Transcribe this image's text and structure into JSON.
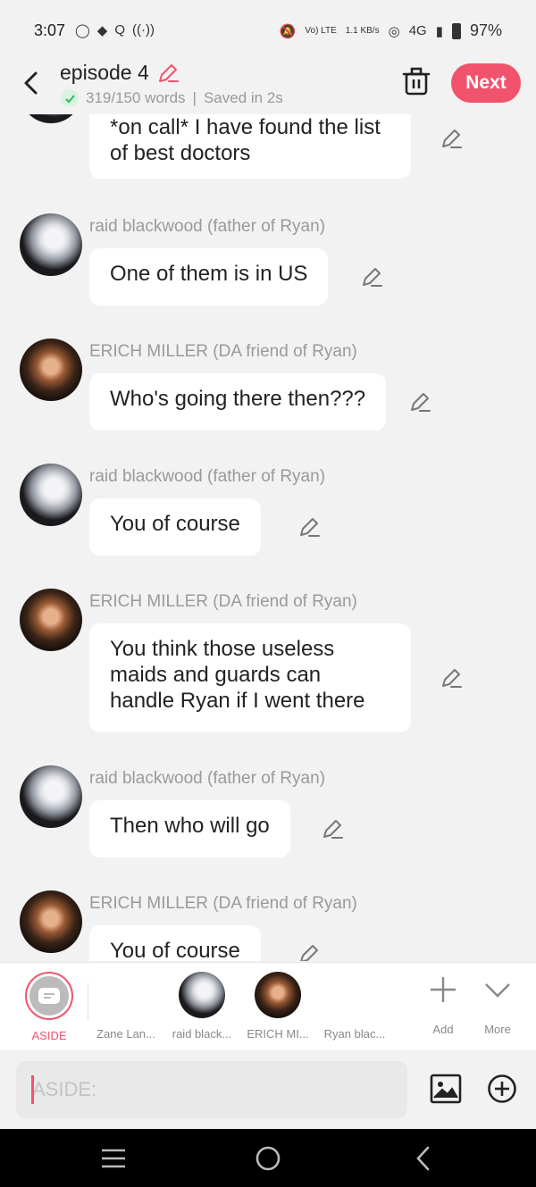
{
  "status": {
    "time": "3:07",
    "network_label": "Vo) LTE",
    "speed": "1.1 KB/s",
    "signal": "4G",
    "battery": "97%"
  },
  "header": {
    "title": "episode 4",
    "word_count": "319/150 words",
    "separator": "|",
    "saved": "Saved in 2s",
    "next_label": "Next"
  },
  "messages": [
    {
      "sender": "",
      "text": "*on call* I have found the list of best doctors",
      "avatar": "raid"
    },
    {
      "sender": "raid blackwood (father of Ryan)",
      "text": "One of them is in US",
      "avatar": "raid"
    },
    {
      "sender": "ERICH MILLER (DA friend of Ryan)",
      "text": "Who's going there then???",
      "avatar": "erich"
    },
    {
      "sender": "raid blackwood (father of Ryan)",
      "text": "You of course",
      "avatar": "raid"
    },
    {
      "sender": "ERICH MILLER (DA friend of Ryan)",
      "text": "You think those useless maids and guards can handle Ryan if I went there",
      "avatar": "erich"
    },
    {
      "sender": "raid blackwood (father of Ryan)",
      "text": "Then who will go",
      "avatar": "raid"
    },
    {
      "sender": "ERICH MILLER (DA friend of Ryan)",
      "text": "You of course",
      "avatar": "erich"
    }
  ],
  "characters": [
    {
      "label": "ASIDE",
      "active": true
    },
    {
      "label": "Zane Lan..."
    },
    {
      "label": "raid black..."
    },
    {
      "label": "ERICH MI..."
    },
    {
      "label": "Ryan blac..."
    }
  ],
  "actions": {
    "add": "Add",
    "more": "More"
  },
  "input": {
    "placeholder": "ASIDE:"
  },
  "colors": {
    "accent": "#f2536c",
    "bubble": "#ffffff",
    "background": "#f2f2f2"
  }
}
